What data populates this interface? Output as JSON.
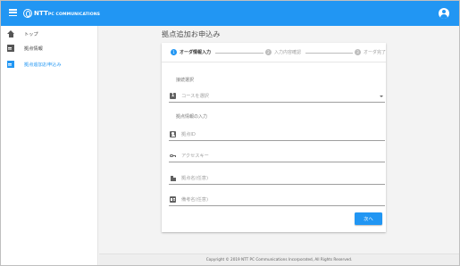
{
  "header": {
    "logo_text": "NTT",
    "logo_text_small": "PC COMMUNICATIONS",
    "menu_icon": "hamburger-icon",
    "account_icon": "account-circle-icon",
    "bar_color": "#2196f3"
  },
  "sidebar": {
    "items": [
      {
        "label": "トップ",
        "icon": "home-icon",
        "active": false
      },
      {
        "label": "拠点情報",
        "icon": "document-icon",
        "active": false
      },
      {
        "label": "拠点追加お申込み",
        "icon": "document-icon",
        "active": true
      }
    ]
  },
  "main": {
    "title": "拠点追加お申込み",
    "steps": [
      {
        "number": "1",
        "label": "オーダ情報入力",
        "active": true
      },
      {
        "number": "2",
        "label": "入力内容確認",
        "active": false
      },
      {
        "number": "3",
        "label": "オーダ完了",
        "active": false
      }
    ],
    "sections": {
      "course": "接続選択",
      "info": "拠点情報の入力"
    },
    "fields": {
      "course_select": {
        "icon": "number-one-box-icon",
        "placeholder": "コースを選択"
      },
      "location_id": {
        "icon": "account-box-icon",
        "placeholder": "拠点ID"
      },
      "access_key": {
        "icon": "key-icon",
        "placeholder": "アクセスキー"
      },
      "location_name": {
        "icon": "building-icon",
        "placeholder": "拠点名(任意)"
      },
      "memo": {
        "icon": "id-card-icon",
        "placeholder": "備考名(任意)"
      }
    },
    "next_button": "次へ"
  },
  "footer": {
    "copyright": "Copyright © 2019 NTT PC Communications Incorporated, All Rights Reserved."
  },
  "colors": {
    "accent": "#2196f3",
    "background": "#f3f3f3"
  }
}
